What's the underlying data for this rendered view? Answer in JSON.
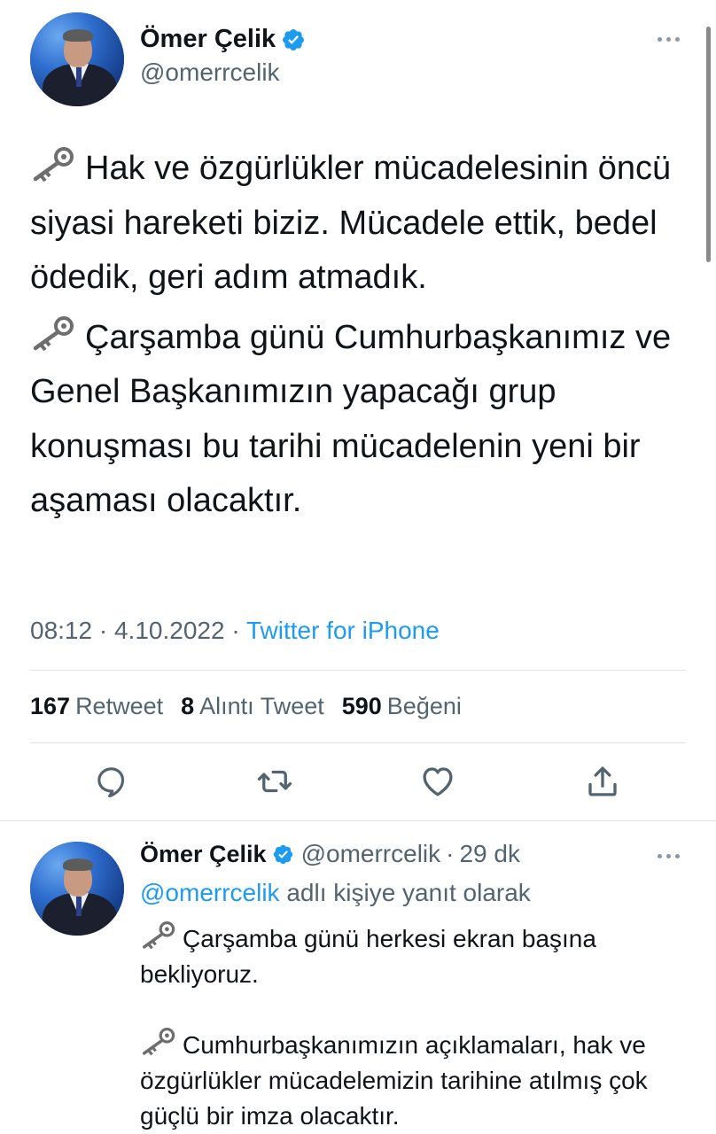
{
  "main_tweet": {
    "author": {
      "name": "Ömer Çelik",
      "handle": "@omerrcelik",
      "verified": true
    },
    "paragraphs": [
      "Hak ve özgürlükler mücadelesinin öncü siyasi hareketi biziz. Mücadele ettik, bedel ödedik, geri adım atmadık.",
      "Çarşamba günü Cumhurbaşkanımız ve Genel Başkanımızın yapacağı grup konuşması bu tarihi mücadelenin yeni bir aşaması olacaktır."
    ],
    "paragraph_icon": "old-key-emoji",
    "time": "08:12",
    "date": "4.10.2022",
    "separator": "·",
    "source": "Twitter for iPhone",
    "stats": {
      "retweets_count": "167",
      "retweets_label": "Retweet",
      "quotes_count": "8",
      "quotes_label": "Alıntı Tweet",
      "likes_count": "590",
      "likes_label": "Beğeni"
    },
    "actions": [
      "reply-icon",
      "retweet-icon",
      "like-icon",
      "share-icon"
    ]
  },
  "reply_tweet": {
    "author": {
      "name": "Ömer Çelik",
      "handle": "@omerrcelik",
      "verified": true
    },
    "separator": "·",
    "time_ago": "29 dk",
    "reply_to_mention": "@omerrcelik",
    "reply_to_suffix": "adlı kişiye yanıt olarak",
    "paragraphs": [
      "Çarşamba günü herkesi ekran başına bekliyoruz.",
      "Cumhurbaşkanımızın açıklamaları, hak ve özgürlükler mücadelemizin tarihine atılmış çok güçlü bir imza olacaktır."
    ]
  },
  "colors": {
    "text": "#0f1419",
    "secondary": "#536471",
    "accent": "#1d9bf0",
    "divider": "#dfe4e8"
  }
}
